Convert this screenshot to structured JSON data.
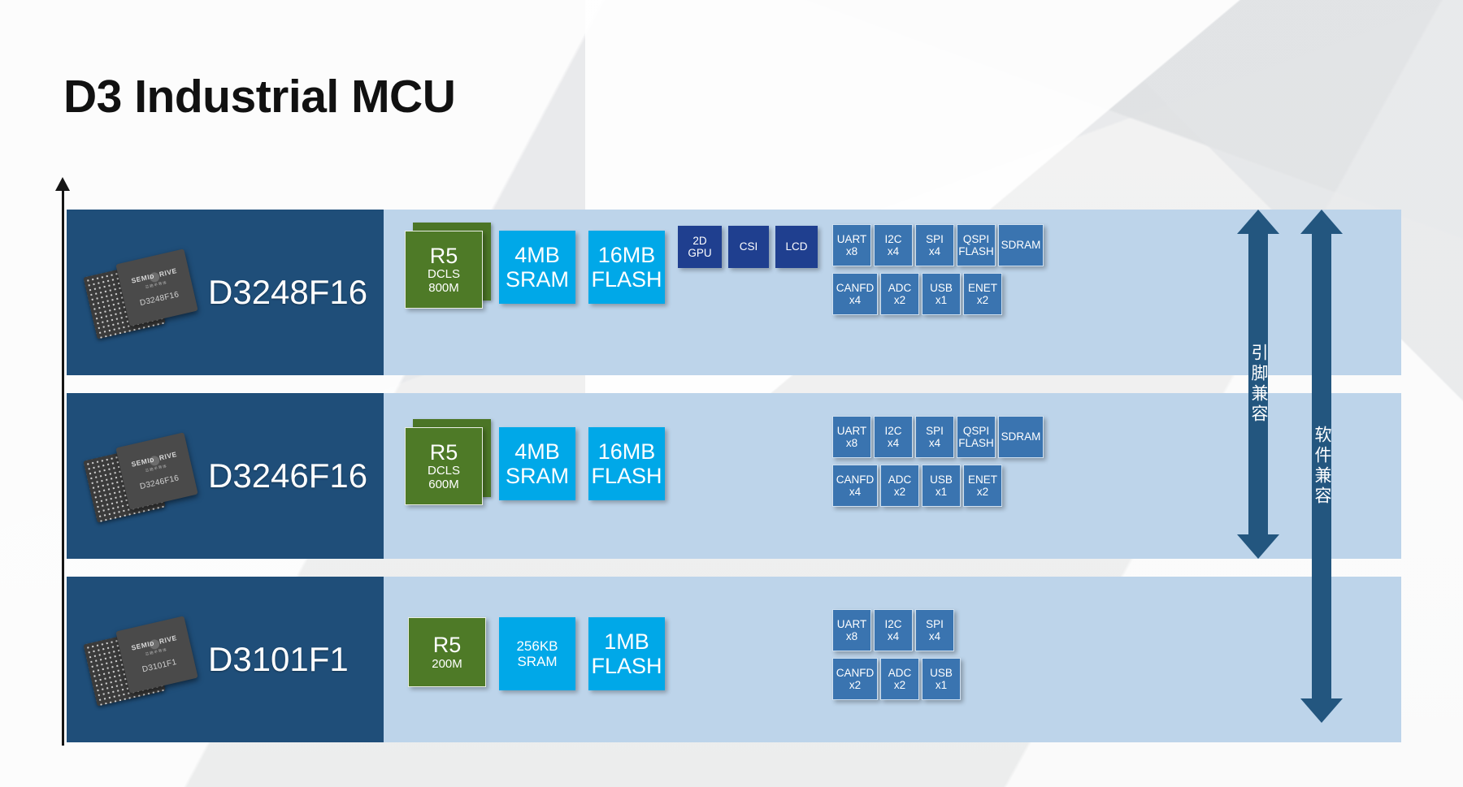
{
  "page": {
    "title": "D3 Industrial MCU"
  },
  "axis": {
    "name": "performance-axis"
  },
  "rows": [
    {
      "part": "D3248F16",
      "chip_brand": "SEMIDRIVE",
      "chip_brand_sub": "芯驰半导体",
      "chip_label": "D3248F16",
      "core": {
        "name": "R5",
        "line2": "DCLS",
        "line3": "800M",
        "stacked": true
      },
      "memories": [
        {
          "line1": "4MB",
          "line2": "SRAM"
        },
        {
          "line1": "16MB",
          "line2": "FLASH"
        }
      ],
      "media": [
        {
          "line1": "2D",
          "line2": "GPU"
        },
        {
          "line1": "CSI",
          "line2": ""
        },
        {
          "line1": "LCD",
          "line2": ""
        }
      ],
      "peripherals_row1": [
        {
          "name": "UART",
          "qty": "x8"
        },
        {
          "name": "I2C",
          "qty": "x4"
        },
        {
          "name": "SPI",
          "qty": "x4"
        },
        {
          "name": "QSPI",
          "qty": "FLASH"
        },
        {
          "name": "SDRAM",
          "qty": ""
        }
      ],
      "peripherals_row2": [
        {
          "name": "CANFD",
          "qty": "x4"
        },
        {
          "name": "ADC",
          "qty": "x2"
        },
        {
          "name": "USB",
          "qty": "x1"
        },
        {
          "name": "ENET",
          "qty": "x2"
        }
      ]
    },
    {
      "part": "D3246F16",
      "chip_brand": "SEMIDRIVE",
      "chip_brand_sub": "芯驰半导体",
      "chip_label": "D3246F16",
      "core": {
        "name": "R5",
        "line2": "DCLS",
        "line3": "600M",
        "stacked": true
      },
      "memories": [
        {
          "line1": "4MB",
          "line2": "SRAM"
        },
        {
          "line1": "16MB",
          "line2": "FLASH"
        }
      ],
      "media": [],
      "peripherals_row1": [
        {
          "name": "UART",
          "qty": "x8"
        },
        {
          "name": "I2C",
          "qty": "x4"
        },
        {
          "name": "SPI",
          "qty": "x4"
        },
        {
          "name": "QSPI",
          "qty": "FLASH"
        },
        {
          "name": "SDRAM",
          "qty": ""
        }
      ],
      "peripherals_row2": [
        {
          "name": "CANFD",
          "qty": "x4"
        },
        {
          "name": "ADC",
          "qty": "x2"
        },
        {
          "name": "USB",
          "qty": "x1"
        },
        {
          "name": "ENET",
          "qty": "x2"
        }
      ]
    },
    {
      "part": "D3101F1",
      "chip_brand": "SEMIDRIVE",
      "chip_brand_sub": "芯驰半导体",
      "chip_label": "D3101F1",
      "core": {
        "name": "R5",
        "line2": "200M",
        "line3": "",
        "stacked": false
      },
      "memories": [
        {
          "line1": "256KB",
          "line2": "SRAM"
        },
        {
          "line1": "1MB",
          "line2": "FLASH"
        }
      ],
      "media": [],
      "peripherals_row1": [
        {
          "name": "UART",
          "qty": "x8"
        },
        {
          "name": "I2C",
          "qty": "x4"
        },
        {
          "name": "SPI",
          "qty": "x4"
        }
      ],
      "peripherals_row2": [
        {
          "name": "CANFD",
          "qty": "x2"
        },
        {
          "name": "ADC",
          "qty": "x2"
        },
        {
          "name": "USB",
          "qty": "x1"
        }
      ]
    }
  ],
  "arrows": [
    {
      "label": "引脚兼容",
      "meaning": "pin-compatible"
    },
    {
      "label": "软件兼容",
      "meaning": "software-compatible"
    }
  ],
  "colors": {
    "header_blue": "#1f4e79",
    "body_blue": "#bdd4ea",
    "core_green": "#4e7a27",
    "memory_cyan": "#00a8e8",
    "media_navy": "#1f3f8f",
    "peripheral_blue": "#3a74b0",
    "arrow_blue": "#23567f"
  }
}
